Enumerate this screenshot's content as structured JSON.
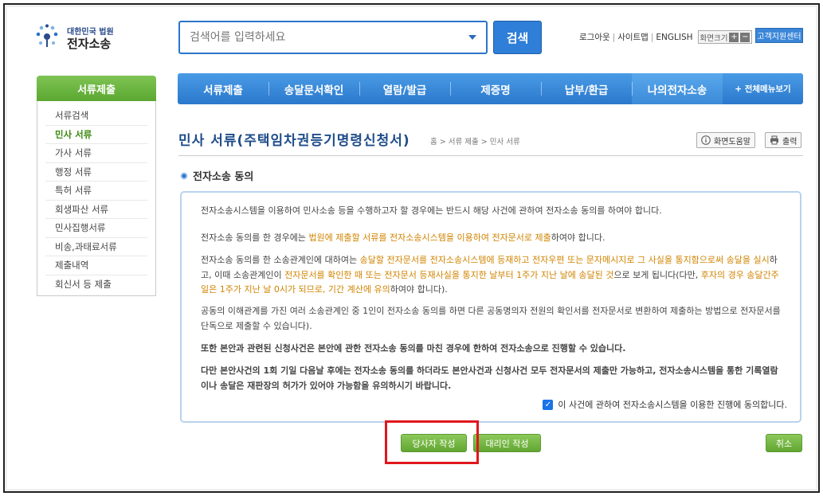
{
  "logo": {
    "line1": "대한민국 법원",
    "line2": "전자소송"
  },
  "search": {
    "placeholder": "검색어를 입력하세요",
    "button_label": "검색"
  },
  "top_links": {
    "logout": "로그아웃",
    "sitemap": "사이트맵",
    "english": "ENGLISH",
    "font_size": "화면크기",
    "font_plus": "+",
    "font_minus": "−",
    "support": "고객지원센터"
  },
  "sidebar": {
    "header": "서류제출",
    "items": [
      {
        "label": "서류검색"
      },
      {
        "label": "민사 서류"
      },
      {
        "label": "가사 서류"
      },
      {
        "label": "행정 서류"
      },
      {
        "label": "특허 서류"
      },
      {
        "label": "회생파산 서류"
      },
      {
        "label": "민사집행서류"
      },
      {
        "label": "비송,과태료서류"
      },
      {
        "label": "제출내역"
      },
      {
        "label": "회신서 등 제출"
      }
    ],
    "active_index": 1
  },
  "nav": {
    "items": [
      {
        "label": "서류제출"
      },
      {
        "label": "송달문서확인"
      },
      {
        "label": "열람/발급"
      },
      {
        "label": "제증명"
      },
      {
        "label": "납부/환급"
      },
      {
        "label": "나의전자소송"
      }
    ],
    "all_menu": "+ 전체메뉴보기"
  },
  "page": {
    "title": "민사 서류(주택임차권등기명령신청서)",
    "breadcrumb": "홈 > 서류 제출 > 민사 서류",
    "help_button": "화면도움말",
    "print_button": "출력"
  },
  "section": {
    "title": "전자소송 동의"
  },
  "agreement": {
    "p1": "전자소송시스템을 이용하여 민사소송 등을 수행하고자 할 경우에는 반드시 해당 사건에 관하여 전자소송 동의를 하여야 합니다.",
    "p2_a": "전자소송 동의를 한 경우에는 ",
    "p2_hl": "법원에 제출할 서류를 전자소송시스템을 이용하여 전자문서로 제출",
    "p2_b": "하여야 합니다.",
    "p3_a": "전자소송 동의를 한 소송관계인에 대하여는 ",
    "p3_hl1": "송달할 전자문서를 전자소송시스템에 등재하고 전자우편 또는 문자메시지로 그 사실을 통지함으로써 송달을 실시",
    "p3_b": "하고, 이때 소송관계인이 ",
    "p3_hl2": "전자문서를 확인한 때 또는 전자문서 등재사실을 통지한 날부터 1주가 지난 날에 송달된 것",
    "p3_c": "으로 보게 됩니다(다만, ",
    "p3_hl3": "후자의 경우 송달간주일은 1주가 지난 날 0시가 되므로, 기간 계산에 유의",
    "p3_d": "하여야 합니다).",
    "p4": "공동의 이해관계를 가진 여러 소송관계인 중 1인이 전자소송 동의를 하면 다른 공동명의자 전원의 확인서를 전자문서로 변환하여 제출하는 방법으로 전자문서를 단독으로 제출할 수 있습니다).",
    "p5": "또한 본안과 관련된 신청사건은 본안에 관한 전자소송 동의를 마친 경우에 한하여 전자소송으로 진행할 수 있습니다.",
    "p6": "다만 본안사건의 1회 기일 다음날 후에는 전자소송 동의를 하더라도 본안사건과 신청사건 모두 전자문서의 제출만 가능하고, 전자소송시스템을 통한 기록열람이나 송달은 재판장의 허가가 있어야 가능함을 유의하시기 바랍니다.",
    "checkbox_label": "이 사건에 관하여 전자소송시스템을 이용한 진행에 동의합니다.",
    "checked": true
  },
  "buttons": {
    "party": "당사자 작성",
    "agent": "대리인 작성",
    "cancel": "취소"
  },
  "colors": {
    "nav_blue": "#2a78cc",
    "sidebar_green": "#5aa730",
    "highlight_orange": "#d08400",
    "annotation_red": "#e0171c"
  }
}
